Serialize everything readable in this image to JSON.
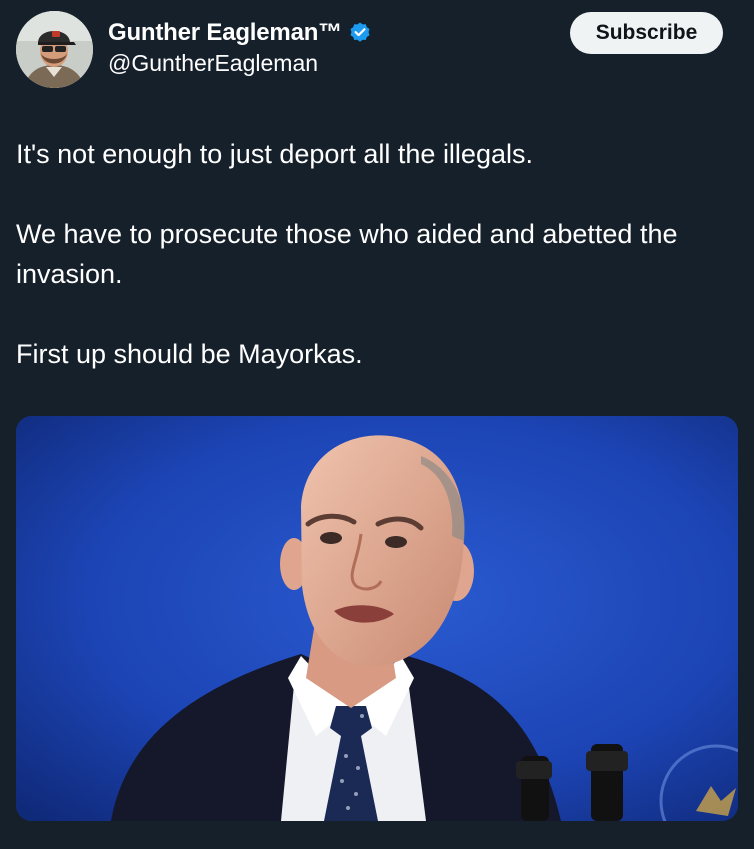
{
  "author": {
    "display_name": "Gunther Eagleman™",
    "handle": "@GuntherEagleman",
    "verified": true,
    "avatar_icon": "profile-photo"
  },
  "actions": {
    "subscribe_label": "Subscribe"
  },
  "tweet": {
    "paragraphs": [
      "It's not enough to just deport all the illegals.",
      "We have to prosecute those who aided and abetted the invasion.",
      "First up should be Mayorkas."
    ]
  },
  "media": {
    "type": "photo",
    "description_icon": "photo-man-at-podium"
  },
  "colors": {
    "background": "#15202b",
    "verified_blue": "#1d9bf0",
    "subscribe_bg": "#eff3f4",
    "text": "#ffffff"
  }
}
